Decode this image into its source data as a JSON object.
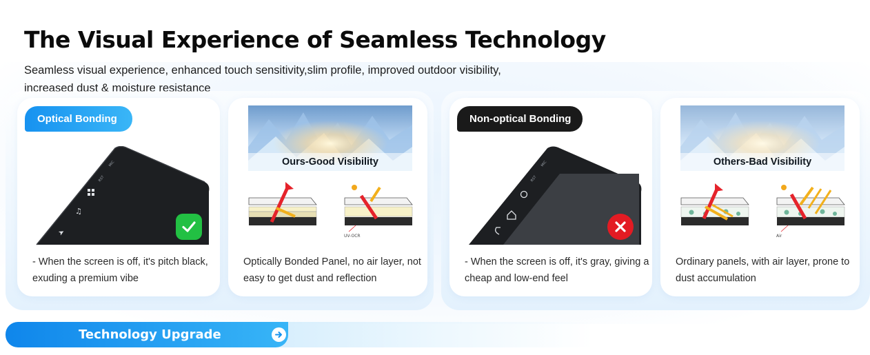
{
  "header": {
    "title": "The Visual Experience of Seamless Technology",
    "subtitle": "Seamless visual experience, enhanced touch sensitivity,slim profile, improved outdoor visibility, increased dust & moisture resistance"
  },
  "optical": {
    "label": "Optical Bonding",
    "screen_description": "- When the screen is off, it's pitch black, exuding a premium vibe",
    "visibility_caption": "Ours-Good Visibility",
    "panel_description": "Optically Bonded Panel, no air layer, not easy to get dust and reflection",
    "diagram_label": "UV-OCR",
    "status_icon": "checkmark-icon",
    "screen_icon_labels": [
      "MIC",
      "RST"
    ]
  },
  "non_optical": {
    "label": "Non-optical Bonding",
    "screen_description": "- When the screen is off, it's gray, giving a cheap and low-end feel",
    "visibility_caption": "Others-Bad Visibility",
    "panel_description": "Ordinary panels, with air layer, prone to dust accumulation",
    "diagram_label": "Air",
    "status_icon": "cross-icon",
    "screen_icon_labels": [
      "MIC",
      "RST"
    ]
  },
  "cta": {
    "label": "Technology Upgrade",
    "icon": "arrow-right-circle-icon"
  },
  "colors": {
    "accent_blue": "#1792f0",
    "success_green": "#22c043",
    "error_red": "#e31b23",
    "dark_pill": "#1a1a1a"
  }
}
